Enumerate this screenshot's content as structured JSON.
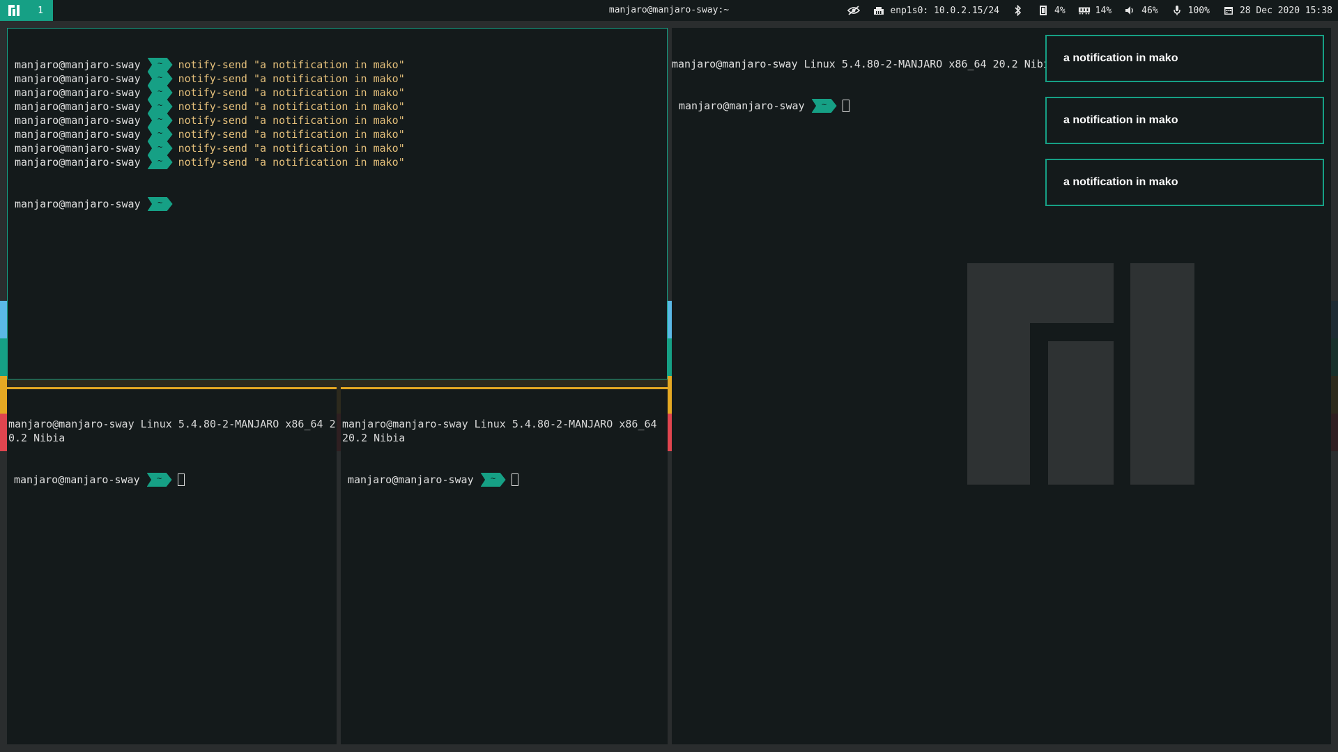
{
  "bar": {
    "workspace": "1",
    "title": "manjaro@manjaro-sway:~",
    "network": "enp1s0: 10.0.2.15/24",
    "cpu": "4%",
    "memory": "14%",
    "volume": "46%",
    "mic": "100%",
    "datetime": "28 Dec 2020 15:38"
  },
  "terminal1": {
    "user": "manjaro@manjaro-sway",
    "tilde": "~",
    "command": "notify-send \"a notification in mako\"",
    "repeat": 8
  },
  "terminal2": {
    "banner": "manjaro@manjaro-sway Linux 5.4.80-2-MANJARO x86_64 20.2 Nibia",
    "user": "manjaro@manjaro-sway",
    "tilde": "~"
  },
  "terminal3": {
    "banner": "manjaro@manjaro-sway Linux 5.4.80-2-MANJARO x86_64 20.2 Nibia",
    "user": "manjaro@manjaro-sway",
    "tilde": "~"
  },
  "terminal4": {
    "banner": "manjaro@manjaro-sway Linux 5.4.80-2-MANJARO x86_64 20.2 Nibia",
    "user": "manjaro@manjaro-sway",
    "tilde": "~"
  },
  "notifications": [
    {
      "text": "a notification in mako"
    },
    {
      "text": "a notification in mako"
    },
    {
      "text": "a notification in mako"
    }
  ],
  "colors": {
    "accent": "#16a085",
    "focus_bottom": "#e5a823",
    "band_blue": "#5bb8e6",
    "band_red": "#e0454f"
  },
  "icons": [
    "manjaro-logo-icon",
    "eye-off-icon",
    "ethernet-icon",
    "bluetooth-icon",
    "cpu-icon",
    "memory-icon",
    "volume-icon",
    "microphone-icon",
    "calendar-icon"
  ]
}
